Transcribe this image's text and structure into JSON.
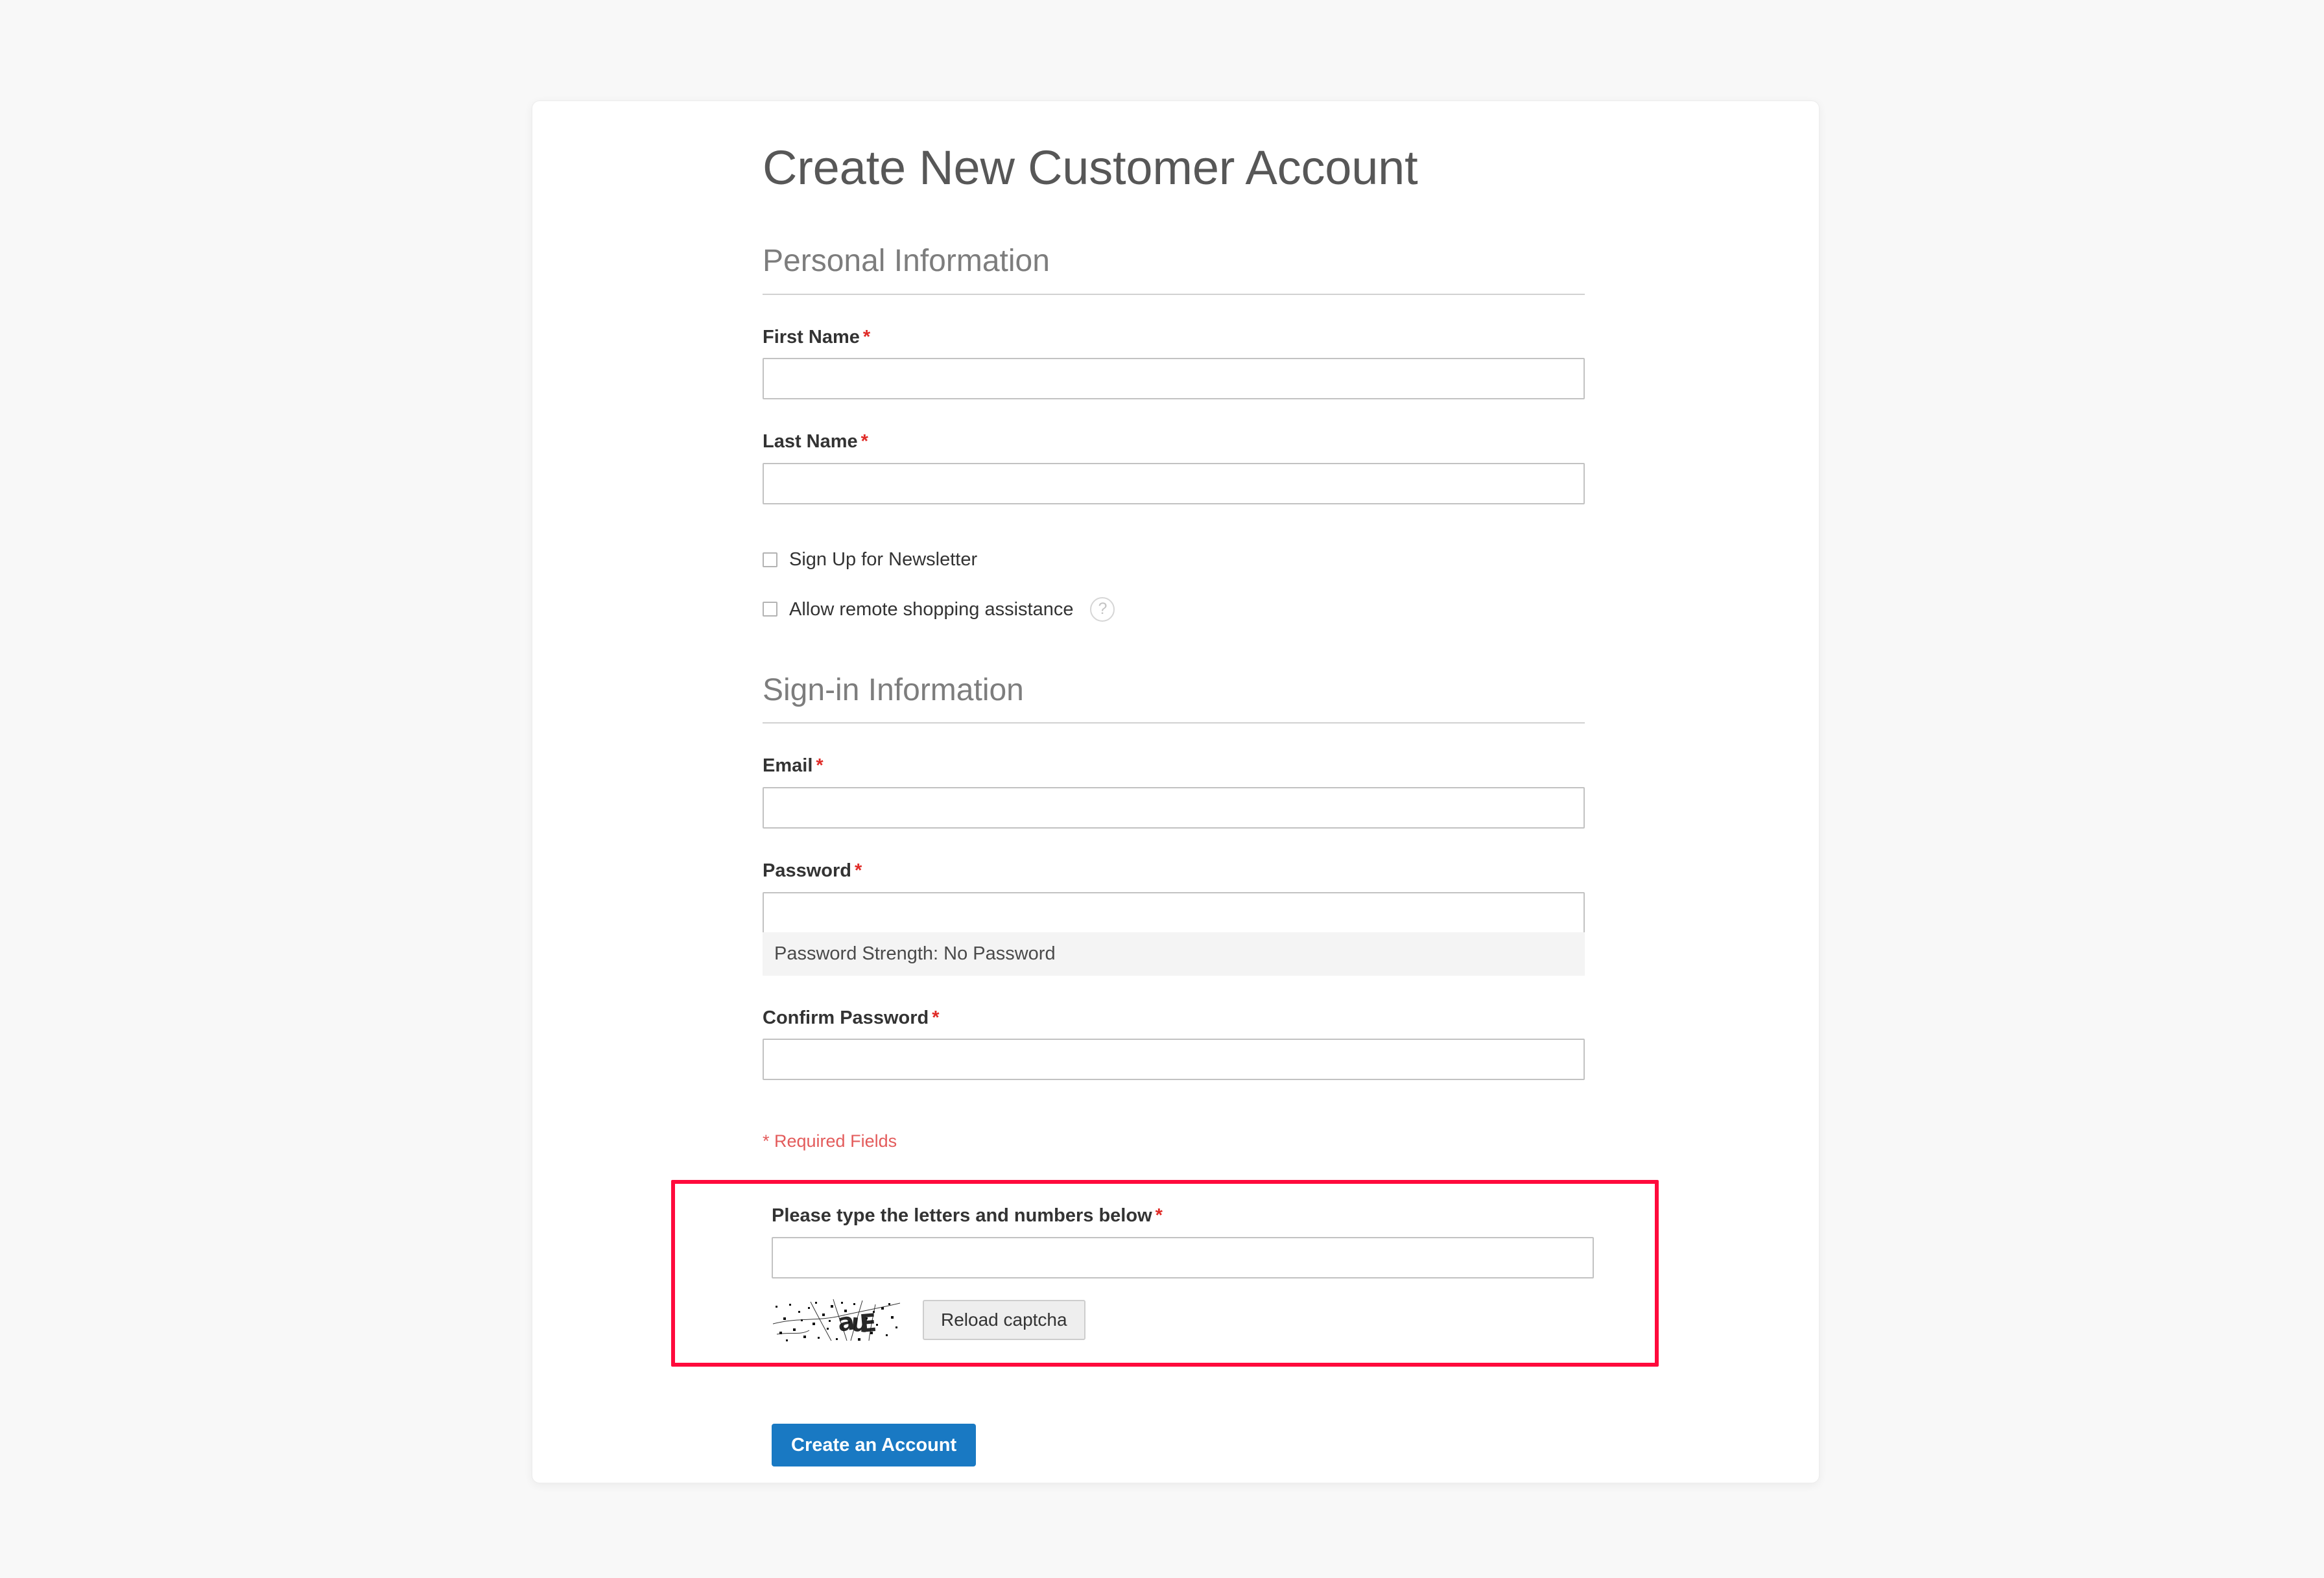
{
  "page": {
    "title": "Create New Customer Account",
    "background_color": "#f8f8f8",
    "card_background": "#ffffff"
  },
  "personal_information": {
    "legend": "Personal Information",
    "first_name": {
      "label": "First Name",
      "required_marker": "*",
      "value": "",
      "placeholder": ""
    },
    "last_name": {
      "label": "Last Name",
      "required_marker": "*",
      "value": "",
      "placeholder": ""
    },
    "newsletter": {
      "label": "Sign Up for Newsletter",
      "checked": false
    },
    "remote_assistance": {
      "label": "Allow remote shopping assistance",
      "checked": false,
      "help_icon": "question-mark-icon",
      "help_glyph": "?"
    }
  },
  "signin_information": {
    "legend": "Sign-in Information",
    "email": {
      "label": "Email",
      "required_marker": "*",
      "value": "",
      "placeholder": ""
    },
    "password": {
      "label": "Password",
      "required_marker": "*",
      "value": "",
      "placeholder": ""
    },
    "password_strength": "Password Strength: No Password",
    "confirm_password": {
      "label": "Confirm Password",
      "required_marker": "*",
      "value": "",
      "placeholder": ""
    }
  },
  "required_note": "* Required Fields",
  "captcha": {
    "label": "Please type the letters and numbers below",
    "required_marker": "*",
    "value": "",
    "placeholder": "",
    "image_alt": "captcha-image",
    "reload_label": "Reload captcha",
    "highlight_color": "#ff0a3c"
  },
  "actions": {
    "submit_label": "Create an Account",
    "submit_color": "#1979c3"
  }
}
